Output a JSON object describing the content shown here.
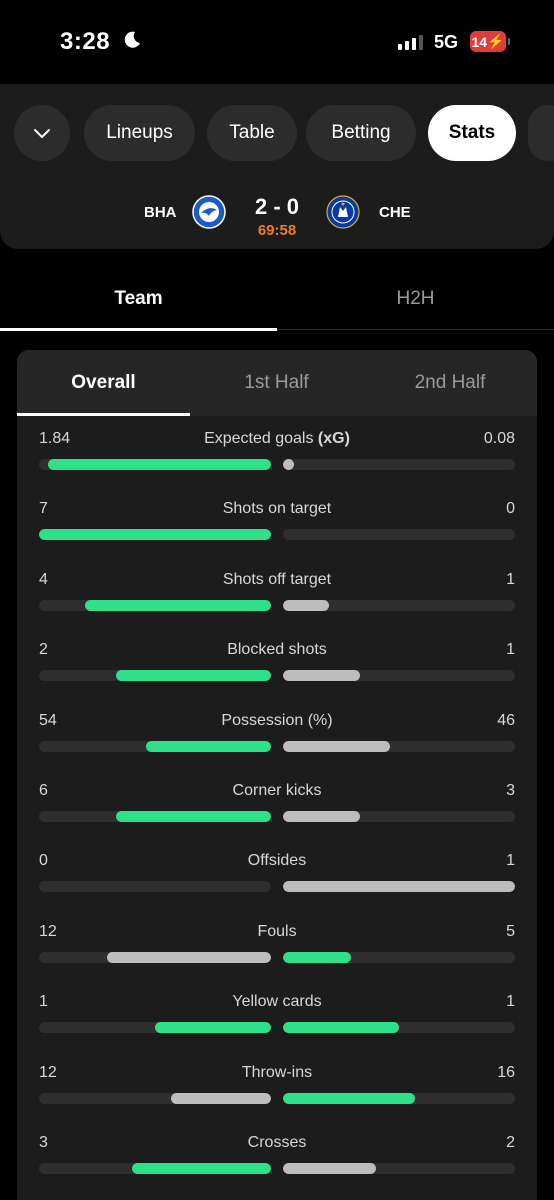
{
  "status_bar": {
    "time": "3:28",
    "moon_icon": "moon-icon",
    "network": "5G",
    "battery": "14"
  },
  "nav": {
    "tabs": [
      {
        "label": "Lineups"
      },
      {
        "label": "Table"
      },
      {
        "label": "Betting"
      },
      {
        "label": "Stats"
      }
    ],
    "active_tab": "Stats"
  },
  "match": {
    "home": "BHA",
    "away": "CHE",
    "score": "2 - 0",
    "clock": "69:58"
  },
  "view_tabs": [
    {
      "label": "Team"
    },
    {
      "label": "H2H"
    }
  ],
  "periods": [
    {
      "label": "Overall"
    },
    {
      "label": "1st Half"
    },
    {
      "label": "2nd Half"
    }
  ],
  "colors": {
    "leader": "#2fe08a",
    "trailer": "#bdbdbd",
    "clock": "#f07c28",
    "battery": "#e33b3b"
  },
  "stats": [
    {
      "name": "Expected goals",
      "suffix": "(xG)",
      "home": "1.84",
      "away": "0.08",
      "home_frac": 0.96,
      "away_frac": 0.0,
      "leader": "home"
    },
    {
      "name": "Shots on target",
      "home": "7",
      "away": "0",
      "home_frac": 1.0,
      "away_frac": 0.0,
      "leader": "home"
    },
    {
      "name": "Shots off target",
      "home": "4",
      "away": "1",
      "home_frac": 0.8,
      "away_frac": 0.2,
      "leader": "home"
    },
    {
      "name": "Blocked shots",
      "home": "2",
      "away": "1",
      "home_frac": 0.667,
      "away_frac": 0.333,
      "leader": "home"
    },
    {
      "name": "Possession (%)",
      "home": "54",
      "away": "46",
      "home_frac": 0.54,
      "away_frac": 0.46,
      "leader": "home"
    },
    {
      "name": "Corner kicks",
      "home": "6",
      "away": "3",
      "home_frac": 0.667,
      "away_frac": 0.333,
      "leader": "home"
    },
    {
      "name": "Offsides",
      "home": "0",
      "away": "1",
      "home_frac": 0.0,
      "away_frac": 1.0,
      "leader": "away_neutral"
    },
    {
      "name": "Fouls",
      "home": "12",
      "away": "5",
      "home_frac": 0.706,
      "away_frac": 0.294,
      "leader": "away"
    },
    {
      "name": "Yellow cards",
      "home": "1",
      "away": "1",
      "home_frac": 0.5,
      "away_frac": 0.5,
      "leader": "both"
    },
    {
      "name": "Throw-ins",
      "home": "12",
      "away": "16",
      "home_frac": 0.429,
      "away_frac": 0.571,
      "leader": "away"
    },
    {
      "name": "Crosses",
      "home": "3",
      "away": "2",
      "home_frac": 0.6,
      "away_frac": 0.4,
      "leader": "home"
    }
  ]
}
